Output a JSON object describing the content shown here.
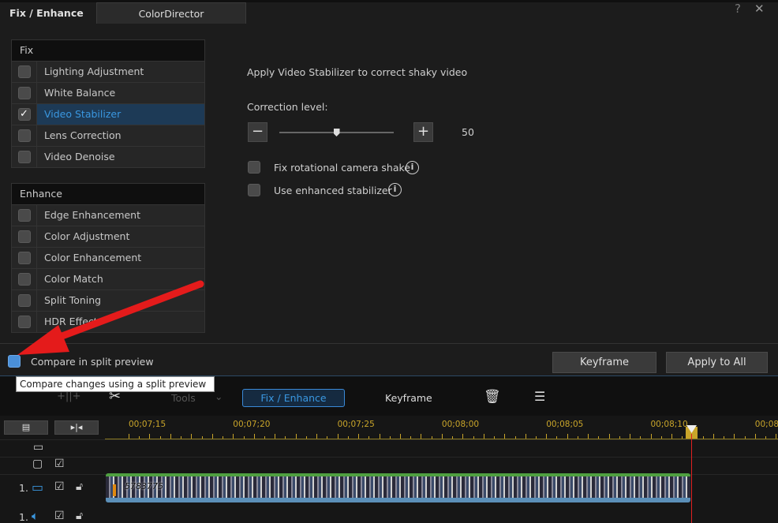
{
  "tabs": [
    {
      "label": "Fix / Enhance",
      "active": true
    },
    {
      "label": "ColorDirector",
      "active": false
    }
  ],
  "window_icons": {
    "help": "?",
    "close": "✕"
  },
  "fix": {
    "header": "Fix",
    "items": [
      {
        "label": "Lighting Adjustment",
        "checked": false
      },
      {
        "label": "White Balance",
        "checked": false
      },
      {
        "label": "Video Stabilizer",
        "checked": true,
        "selected": true
      },
      {
        "label": "Lens Correction",
        "checked": false
      },
      {
        "label": "Video Denoise",
        "checked": false
      }
    ]
  },
  "enhance": {
    "header": "Enhance",
    "items": [
      {
        "label": "Edge Enhancement",
        "checked": false
      },
      {
        "label": "Color Adjustment",
        "checked": false
      },
      {
        "label": "Color Enhancement",
        "checked": false
      },
      {
        "label": "Color Match",
        "checked": false
      },
      {
        "label": "Split Toning",
        "checked": false
      },
      {
        "label": "HDR Effect",
        "checked": false
      }
    ]
  },
  "stabilizer": {
    "description": "Apply Video Stabilizer to correct shaky video",
    "correction_label": "Correction level:",
    "minus": "−",
    "plus": "+",
    "value": "50",
    "slider_percent": 50,
    "options": [
      {
        "label": "Fix rotational camera shake",
        "checked": false
      },
      {
        "label": "Use enhanced stabilizer",
        "checked": false
      }
    ]
  },
  "bottom": {
    "compare_label": "Compare in split preview",
    "keyframe": "Keyframe",
    "apply_all": "Apply to All",
    "tooltip": "Compare changes using a split preview"
  },
  "toolbar": {
    "tools": "Tools",
    "fix_enhance": "Fix / Enhance",
    "keyframe": "Keyframe"
  },
  "timeline": {
    "ticks": [
      "00;07;15",
      "00;07;20",
      "00;07;25",
      "00;08;00",
      "00;08;05",
      "00;08;10",
      "00;08;"
    ],
    "clip_label": "5783775",
    "track_video": "1.",
    "track_audio": "1."
  },
  "colors": {
    "accent": "#3a97e0",
    "ruler": "#c9a52a",
    "playhead": "#e02020",
    "arrow": "#e41b1b"
  }
}
